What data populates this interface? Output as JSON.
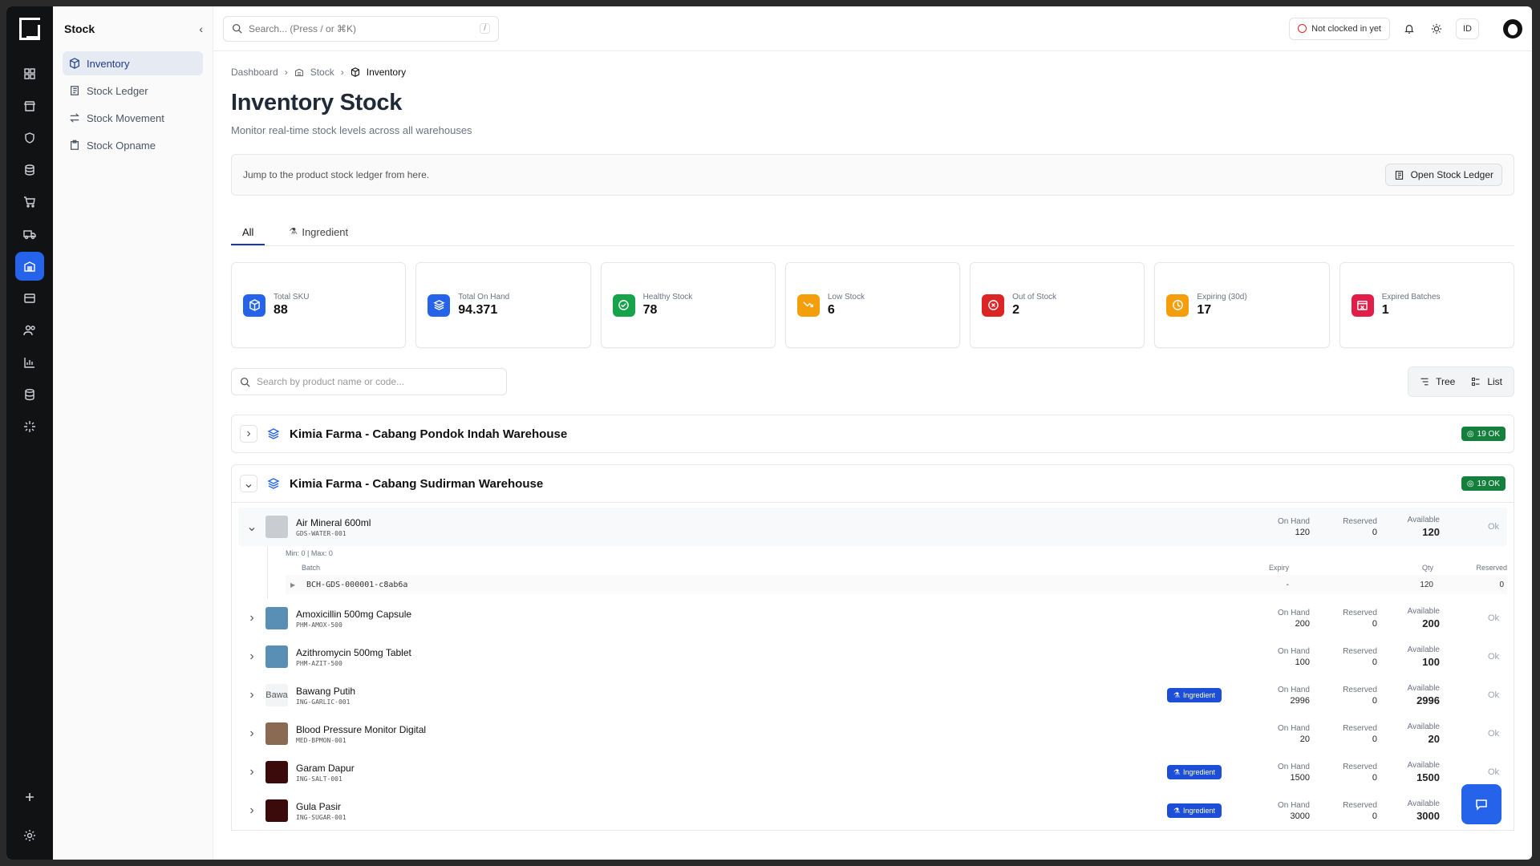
{
  "sidebar": {
    "title": "Stock",
    "items": [
      {
        "label": "Inventory",
        "active": true,
        "icon": "cube-icon"
      },
      {
        "label": "Stock Ledger",
        "active": false,
        "icon": "ledger-icon"
      },
      {
        "label": "Stock Movement",
        "active": false,
        "icon": "arrows-icon"
      },
      {
        "label": "Stock Opname",
        "active": false,
        "icon": "clipboard-icon"
      }
    ]
  },
  "topbar": {
    "search_placeholder": "Search... (Press / or ⌘K)",
    "search_kbd": "/",
    "clock_status": "Not clocked in yet",
    "language": "ID"
  },
  "breadcrumb": [
    "Dashboard",
    "Stock",
    "Inventory"
  ],
  "page": {
    "title": "Inventory Stock",
    "subtitle": "Monitor real-time stock levels across all warehouses"
  },
  "jump": {
    "text": "Jump to the product stock ledger from here.",
    "button": "Open Stock Ledger"
  },
  "tabs": [
    {
      "label": "All",
      "active": true
    },
    {
      "label": "Ingredient",
      "active": false
    }
  ],
  "stats": [
    {
      "label": "Total SKU",
      "value": "88",
      "color": "#2563eb",
      "icon": "cube-icon"
    },
    {
      "label": "Total On Hand",
      "value": "94.371",
      "color": "#2563eb",
      "icon": "layers-icon"
    },
    {
      "label": "Healthy Stock",
      "value": "78",
      "color": "#16a34a",
      "icon": "check-circle-icon"
    },
    {
      "label": "Low Stock",
      "value": "6",
      "color": "#f59e0b",
      "icon": "trend-down-icon"
    },
    {
      "label": "Out of Stock",
      "value": "2",
      "color": "#dc2626",
      "icon": "x-circle-icon"
    },
    {
      "label": "Expiring (30d)",
      "value": "17",
      "color": "#f59e0b",
      "icon": "clock-icon"
    },
    {
      "label": "Expired Batches",
      "value": "1",
      "color": "#e11d48",
      "icon": "calendar-x-icon"
    }
  ],
  "filter": {
    "placeholder": "Search by product name or code...",
    "tree_label": "Tree",
    "list_label": "List"
  },
  "warehouses": [
    {
      "name": "Kimia Farma - Cabang Pondok Indah Warehouse",
      "badge": "19 OK",
      "expanded": false
    },
    {
      "name": "Kimia Farma - Cabang Sudirman Warehouse",
      "badge": "19 OK",
      "expanded": true
    }
  ],
  "labels": {
    "on_hand": "On Hand",
    "reserved": "Reserved",
    "available": "Available",
    "ingredient": "Ingredient",
    "batch": "Batch",
    "expiry": "Expiry",
    "qty": "Qty",
    "min_max": "Min: 0 | Max: 0"
  },
  "products": [
    {
      "name": "Air Mineral 600ml",
      "code": "GDS-WATER-001",
      "on_hand": "120",
      "reserved": "0",
      "available": "120",
      "status": "Ok",
      "ingredient": false,
      "open": true,
      "thumb": "",
      "thumb_color": "#c9ccd1"
    },
    {
      "name": "Amoxicillin 500mg Capsule",
      "code": "PHM-AMOX-500",
      "on_hand": "200",
      "reserved": "0",
      "available": "200",
      "status": "Ok",
      "ingredient": false,
      "open": false,
      "thumb": "",
      "thumb_color": "#5a8fb5"
    },
    {
      "name": "Azithromycin 500mg Tablet",
      "code": "PHM-AZIT-500",
      "on_hand": "100",
      "reserved": "0",
      "available": "100",
      "status": "Ok",
      "ingredient": false,
      "open": false,
      "thumb": "",
      "thumb_color": "#5a8fb5"
    },
    {
      "name": "Bawang Putih",
      "code": "ING-GARLIC-001",
      "on_hand": "2996",
      "reserved": "0",
      "available": "2996",
      "status": "Ok",
      "ingredient": true,
      "open": false,
      "thumb": "Bawa",
      "thumb_color": "#f3f4f6"
    },
    {
      "name": "Blood Pressure Monitor Digital",
      "code": "MED-BPMON-001",
      "on_hand": "20",
      "reserved": "0",
      "available": "20",
      "status": "Ok",
      "ingredient": false,
      "open": false,
      "thumb": "",
      "thumb_color": "#8a6a52"
    },
    {
      "name": "Garam Dapur",
      "code": "ING-SALT-001",
      "on_hand": "1500",
      "reserved": "0",
      "available": "1500",
      "status": "Ok",
      "ingredient": true,
      "open": false,
      "thumb": "",
      "thumb_color": "#3b0b0b"
    },
    {
      "name": "Gula Pasir",
      "code": "ING-SUGAR-001",
      "on_hand": "3000",
      "reserved": "0",
      "available": "3000",
      "status": "Ok",
      "ingredient": true,
      "open": false,
      "thumb": "",
      "thumb_color": "#3b0b0b"
    }
  ],
  "batch": {
    "code": "BCH-GDS-000001-c8ab6a",
    "expiry": "-",
    "qty": "120",
    "reserved": "0"
  }
}
